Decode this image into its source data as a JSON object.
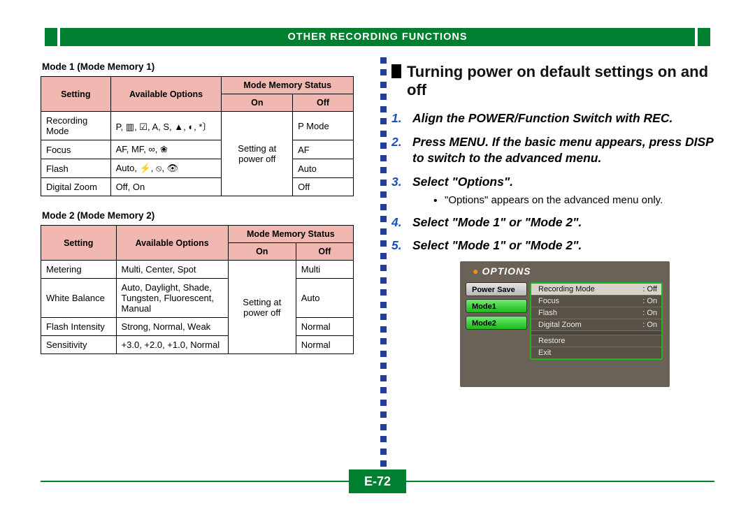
{
  "header": {
    "title": "OTHER RECORDING FUNCTIONS"
  },
  "page_number": "E-72",
  "left": {
    "table1": {
      "caption": "Mode 1 (Mode Memory 1)",
      "headers": {
        "setting": "Setting",
        "options": "Available Options",
        "status": "Mode Memory Status",
        "on": "On",
        "off": "Off"
      },
      "on_merged": "Setting at power off",
      "rows": [
        {
          "setting": "Recording Mode",
          "options": "P, ▥, ☑, A, S, ▲, ◐, *〕",
          "off": "P Mode"
        },
        {
          "setting": "Focus",
          "options": "AF, MF, ∞, ❀",
          "off": "AF"
        },
        {
          "setting": "Flash",
          "options": "Auto, ⚡, ⦸, 👁",
          "off": "Auto"
        },
        {
          "setting": "Digital Zoom",
          "options": "Off, On",
          "off": "Off"
        }
      ]
    },
    "table2": {
      "caption": "Mode 2 (Mode Memory 2)",
      "headers": {
        "setting": "Setting",
        "options": "Available Options",
        "status": "Mode Memory Status",
        "on": "On",
        "off": "Off"
      },
      "on_merged": "Setting at power off",
      "rows": [
        {
          "setting": "Metering",
          "options": "Multi, Center, Spot",
          "off": "Multi"
        },
        {
          "setting": "White Balance",
          "options": "Auto, Daylight, Shade, Tungsten, Fluorescent, Manual",
          "off": "Auto"
        },
        {
          "setting": "Flash Intensity",
          "options": "Strong, Normal, Weak",
          "off": "Normal"
        },
        {
          "setting": "Sensitivity",
          "options": "+3.0, +2.0, +1.0, Normal",
          "off": "Normal"
        }
      ]
    }
  },
  "right": {
    "title": "Turning power on default settings on and off",
    "steps": [
      {
        "text": "Align the POWER/Function Switch with REC."
      },
      {
        "text": "Press MENU. If the basic menu appears, press DISP to switch to the advanced menu."
      },
      {
        "text": "Select \"Options\".",
        "sub": [
          "\"Options\" appears on the advanced menu only."
        ]
      },
      {
        "text": "Select \"Mode 1\" or \"Mode 2\"."
      },
      {
        "text": "Select \"Mode 1\" or \"Mode 2\"."
      }
    ],
    "screenshot": {
      "title": "OPTIONS",
      "tabs": [
        "Power Save",
        "Mode1",
        "Mode2"
      ],
      "panel": [
        {
          "label": "Recording Mode",
          "value": ": Off",
          "selected": true
        },
        {
          "label": "Focus",
          "value": ": On"
        },
        {
          "label": "Flash",
          "value": ": On"
        },
        {
          "label": "Digital Zoom",
          "value": ": On"
        }
      ],
      "footer": [
        "Restore",
        "Exit"
      ]
    }
  }
}
